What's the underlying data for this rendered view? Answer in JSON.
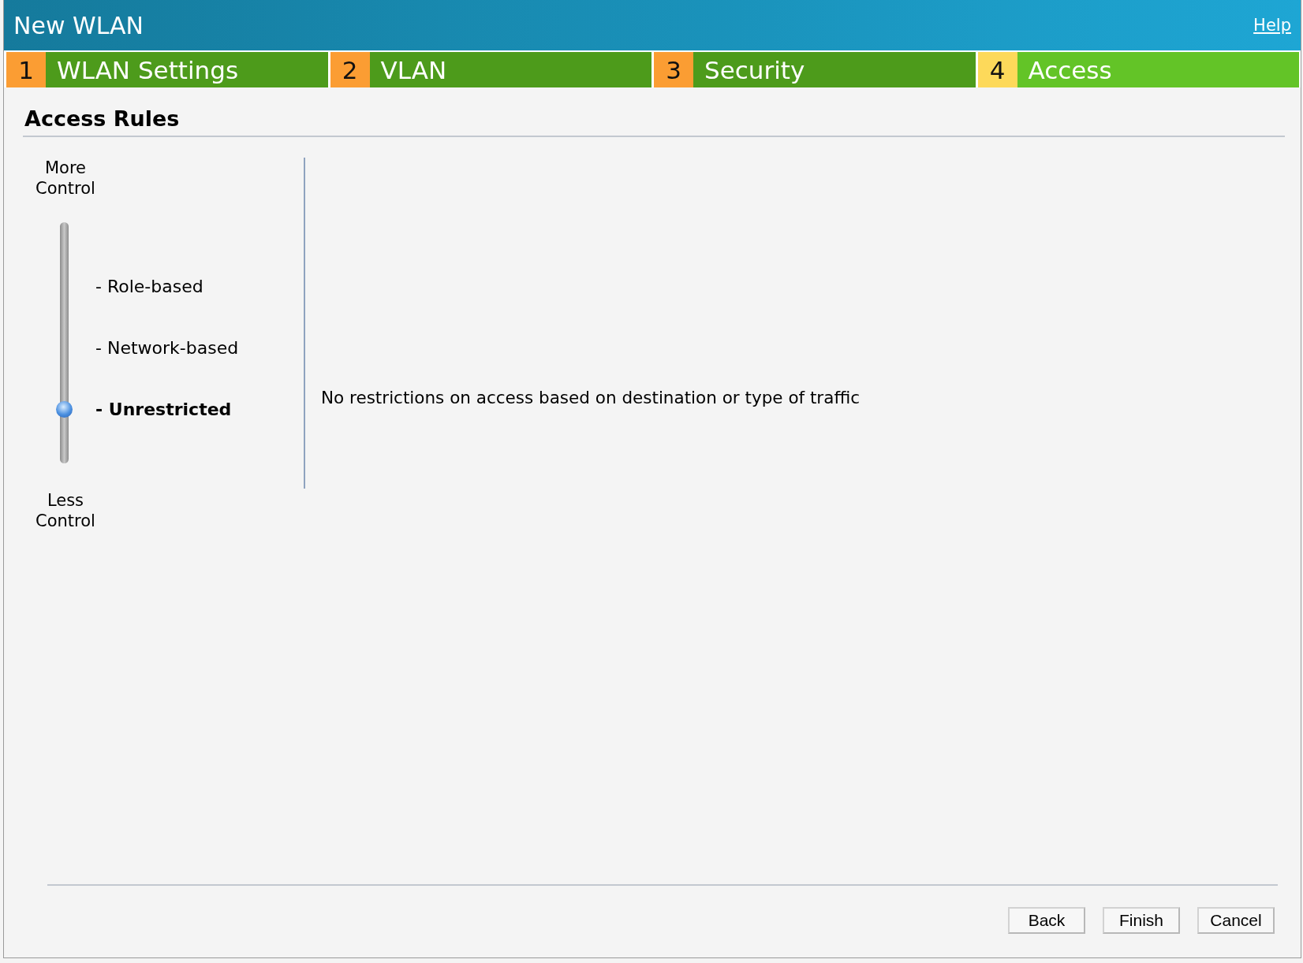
{
  "window": {
    "title": "New WLAN",
    "help_link": "Help"
  },
  "steps": [
    {
      "number": "1",
      "label": "WLAN Settings",
      "selected": false
    },
    {
      "number": "2",
      "label": "VLAN",
      "selected": false
    },
    {
      "number": "3",
      "label": "Security",
      "selected": false
    },
    {
      "number": "4",
      "label": "Access",
      "selected": true
    }
  ],
  "section": {
    "title": "Access Rules"
  },
  "slider": {
    "top_label": "More Control",
    "bottom_label": "Less Control",
    "options": [
      {
        "label": "- Role-based",
        "selected": false
      },
      {
        "label": "- Network-based",
        "selected": false
      },
      {
        "label": "- Unrestricted",
        "selected": true
      }
    ]
  },
  "description": "No restrictions on access based on destination or type of traffic",
  "buttons": [
    "Back",
    "Finish",
    "Cancel"
  ]
}
